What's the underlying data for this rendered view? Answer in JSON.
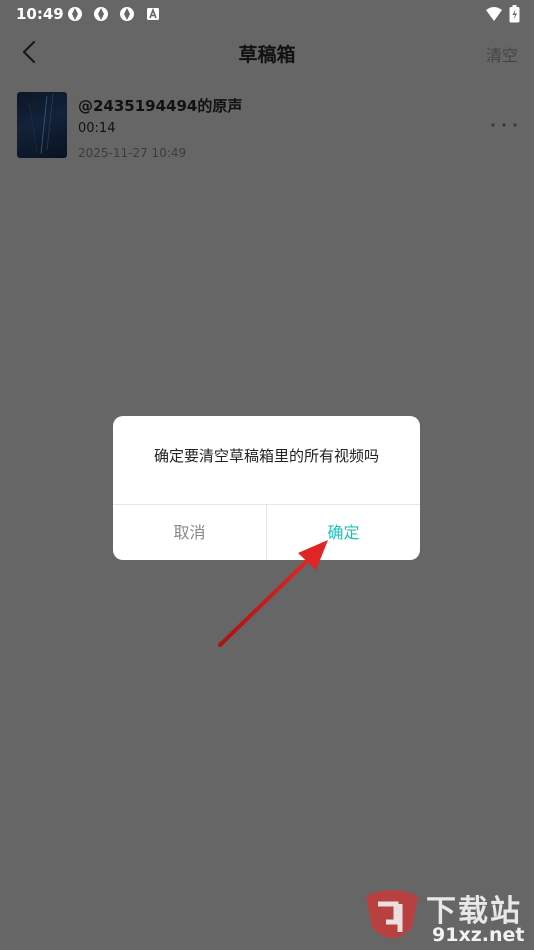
{
  "status_bar": {
    "time": "10:49"
  },
  "header": {
    "title": "草稿箱",
    "clear_label": "清空"
  },
  "draft": {
    "title": "@2435194494的原声",
    "duration": "00:14",
    "date": "2025-11-27 10:49"
  },
  "dialog": {
    "message": "确定要清空草稿箱里的所有视频吗",
    "cancel_label": "取消",
    "confirm_label": "确定"
  },
  "watermark": {
    "text_top": "下载站",
    "text_bottom": "91xz.net"
  },
  "colors": {
    "accent": "#1cc2ba",
    "overlay": "#666666",
    "arrow": "#d61f1f"
  }
}
